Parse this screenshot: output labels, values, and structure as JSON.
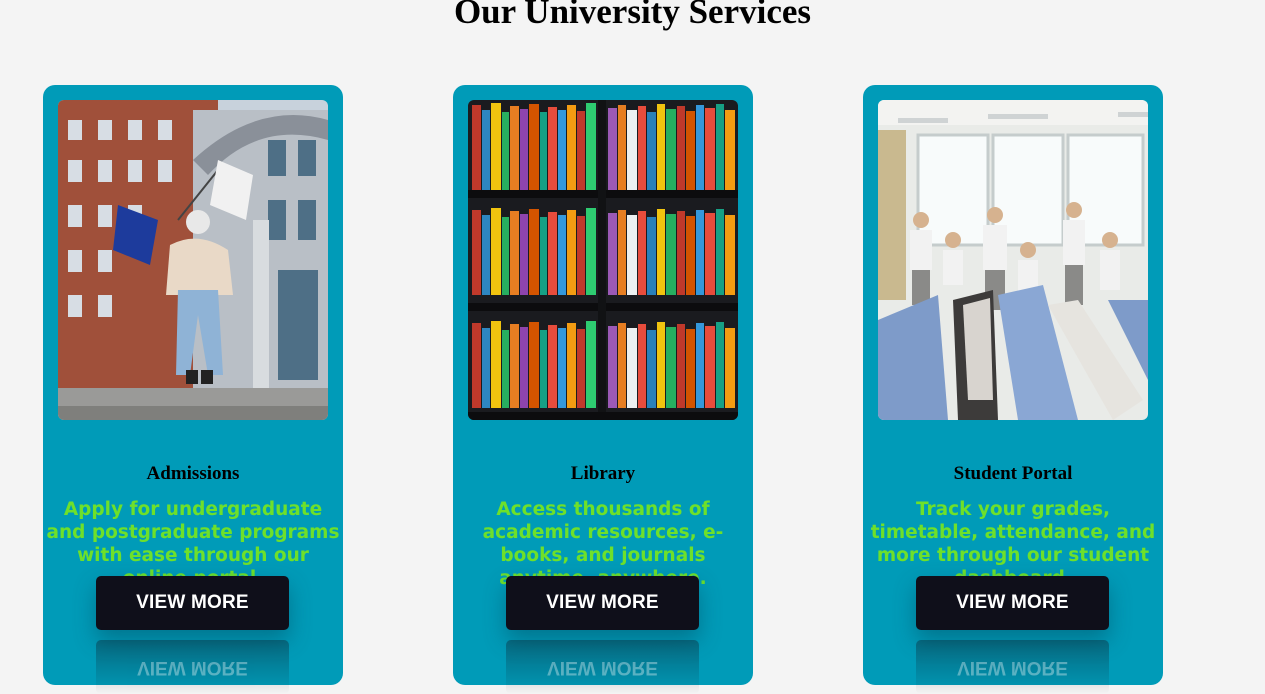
{
  "page": {
    "title": "Our University Services"
  },
  "colors": {
    "background": "#f4f4f4",
    "card": "#009bb8",
    "description_text": "#6ee02a",
    "button": "#0f0f1a",
    "button_text": "#ffffff"
  },
  "cards": [
    {
      "title": "Admissions",
      "description": "Apply for undergraduate and postgraduate programs with ease through our online portal.",
      "button_label": "VIEW MORE",
      "image": "student-with-nyu-flags-photo"
    },
    {
      "title": "Library",
      "description": "Access thousands of academic resources, e-books, and journals anytime, anywhere.",
      "button_label": "VIEW MORE",
      "image": "bookshelves-photo"
    },
    {
      "title": "Student Portal",
      "description": "Track your grades, timetable, attendance, and more through our student dashboard.",
      "button_label": "VIEW MORE",
      "image": "students-in-classroom-photo"
    }
  ]
}
